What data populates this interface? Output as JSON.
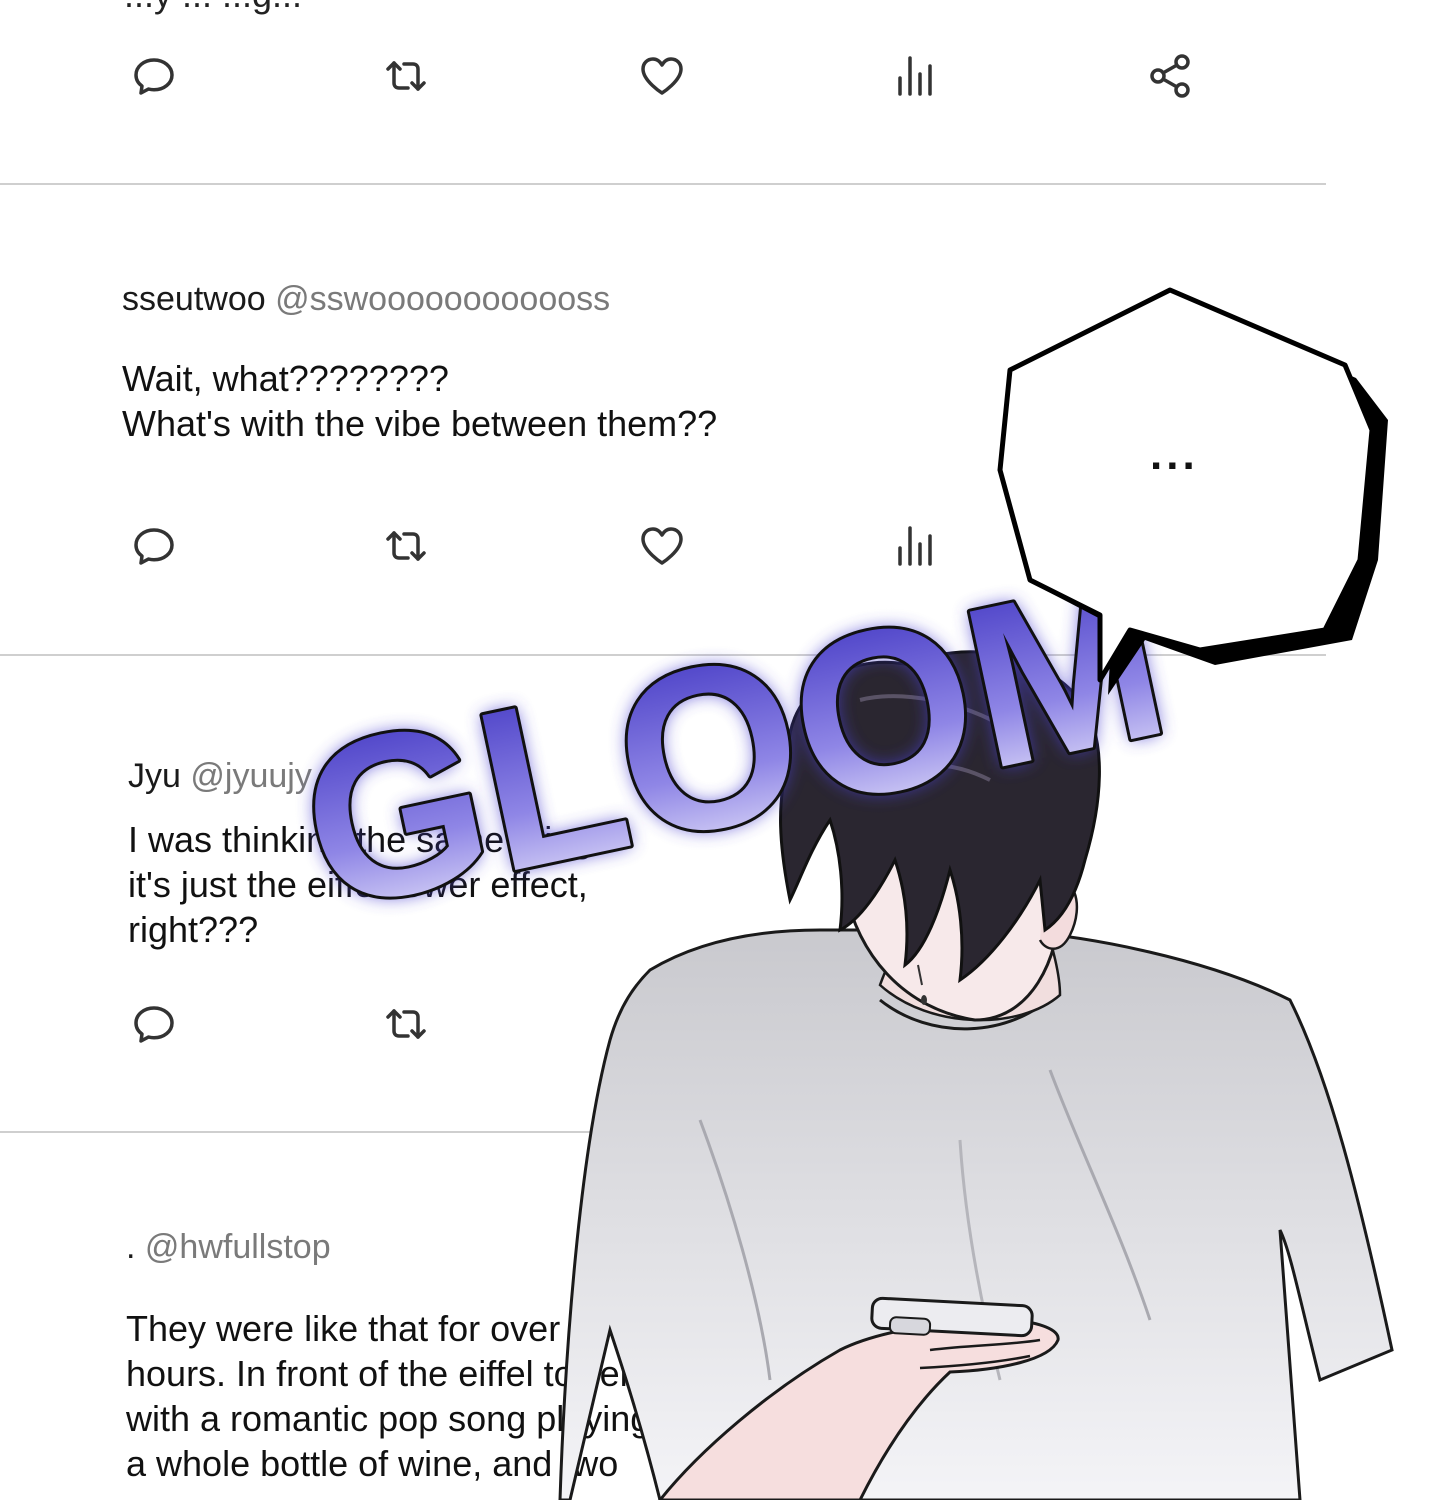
{
  "top_cut_text": "...y ... ...g...",
  "posts": [
    {
      "name": "sseutwoo",
      "handle": "@sswoooooooooooss",
      "lines": [
        "Wait, what????????",
        "What's with the vibe between them??"
      ]
    },
    {
      "name": "Jyu",
      "handle": "@jyuujy",
      "lines": [
        "I was thinking the same thing.",
        "it's just the eiffel tower effect,",
        "right???"
      ]
    },
    {
      "name": ".",
      "handle": "@hwfullstop",
      "lines": [
        "They were like that for over",
        "hours. In front of the eiffel tower",
        "with a romantic pop song playing",
        "a whole bottle of wine, and two"
      ]
    }
  ],
  "icons": [
    "reply-icon",
    "retweet-icon",
    "like-icon",
    "views-icon",
    "share-icon"
  ],
  "speech_bubble": {
    "text": "..."
  },
  "sfx": {
    "text": "GLOOM",
    "color": "#4a3fd0"
  },
  "colors": {
    "divider": "#cfcfcf",
    "handle": "#7a7a7a",
    "icon": "#333333"
  }
}
